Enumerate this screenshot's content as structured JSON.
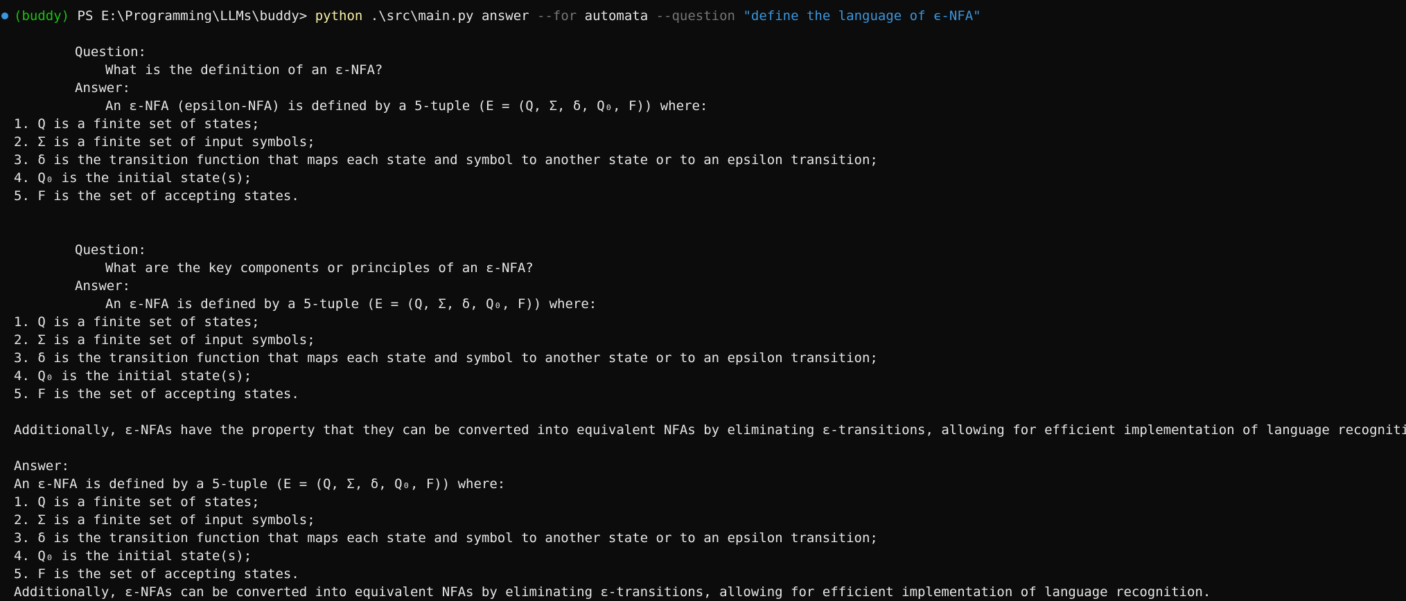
{
  "prompt": {
    "env": "(buddy)",
    "ps": " PS E:\\Programming\\LLMs\\buddy>",
    "command": "python",
    "script": " .\\src\\main.py",
    "subcommand": " answer",
    "flag_for": " --for",
    "for_value": " automata",
    "flag_question": " --question",
    "question_value": " \"define the language of ϵ-NFA\""
  },
  "output": {
    "block1": {
      "question_label": "Question:",
      "question_text": "What is the definition of an ε-NFA?",
      "answer_label": "Answer:",
      "answer_text": "An ε-NFA (epsilon-NFA) is defined by a 5-tuple (E = (Q, Σ, δ, Q₀, F)) where:",
      "items": [
        "1. Q is a finite set of states;",
        "2. Σ is a finite set of input symbols;",
        "3. δ is the transition function that maps each state and symbol to another state or to an epsilon transition;",
        "4. Q₀ is the initial state(s);",
        "5. F is the set of accepting states."
      ]
    },
    "block2": {
      "question_label": "Question:",
      "question_text": "What are the key components or principles of an ε-NFA?",
      "answer_label": "Answer:",
      "answer_text": "An ε-NFA is defined by a 5-tuple (E = (Q, Σ, δ, Q₀, F)) where:",
      "items": [
        "1. Q is a finite set of states;",
        "2. Σ is a finite set of input symbols;",
        "3. δ is the transition function that maps each state and symbol to another state or to an epsilon transition;",
        "4. Q₀ is the initial state(s);",
        "5. F is the set of accepting states."
      ],
      "additional": "Additionally, ε-NFAs have the property that they can be converted into equivalent NFAs by eliminating ε-transitions, allowing for efficient implementation of language recognition."
    },
    "final": {
      "answer_label": "Answer:",
      "answer_text": "An ε-NFA is defined by a 5-tuple (E = (Q, Σ, δ, Q₀, F)) where:",
      "items": [
        "1. Q is a finite set of states;",
        "2. Σ is a finite set of input symbols;",
        "3. δ is the transition function that maps each state and symbol to another state or to an epsilon transition;",
        "4. Q₀ is the initial state(s);",
        "5. F is the set of accepting states."
      ],
      "additional": "Additionally, ε-NFAs can be converted into equivalent NFAs by eliminating ε-transitions, allowing for efficient implementation of language recognition."
    }
  },
  "colors": {
    "background": "#0c0c0c",
    "foreground": "#e6e6e6",
    "env": "#16c60c",
    "command": "#f9f1a5",
    "parameter": "#767676",
    "string": "#3a96dd",
    "status_dot": "#3a96dd"
  }
}
